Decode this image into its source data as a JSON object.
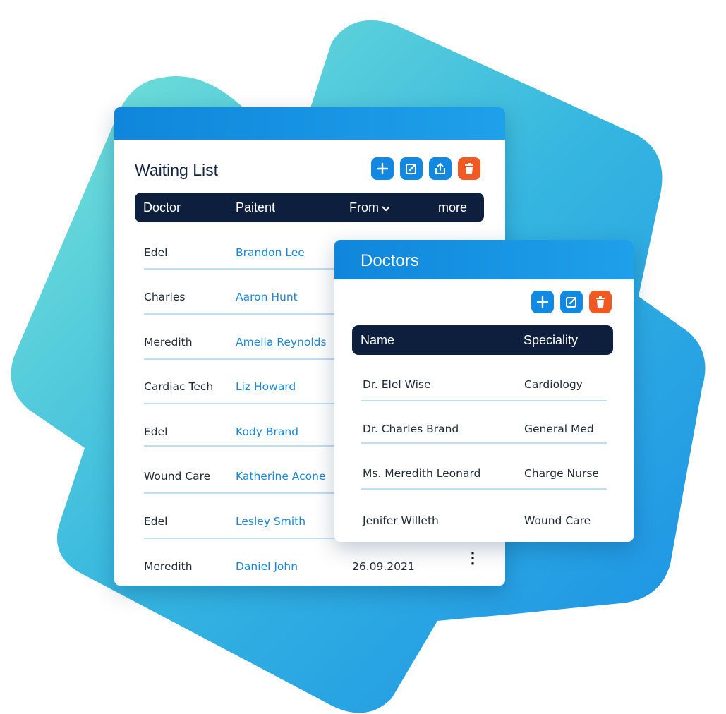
{
  "waiting_list": {
    "title": "Waiting List",
    "columns": {
      "doctor": "Doctor",
      "patient": "Paitent",
      "from": "From",
      "more": "more"
    },
    "rows": [
      {
        "doctor": "Edel",
        "patient": "Brandon Lee",
        "date": ""
      },
      {
        "doctor": "Charles",
        "patient": "Aaron Hunt",
        "date": ""
      },
      {
        "doctor": "Meredith",
        "patient": "Amelia Reynolds",
        "date": ""
      },
      {
        "doctor": "Cardiac Tech",
        "patient": "Liz Howard",
        "date": ""
      },
      {
        "doctor": "Edel",
        "patient": "Kody Brand",
        "date": ""
      },
      {
        "doctor": "Wound Care",
        "patient": "Katherine Acone",
        "date": ""
      },
      {
        "doctor": "Edel",
        "patient": "Lesley Smith",
        "date": ""
      },
      {
        "doctor": "Meredith",
        "patient": "Daniel John",
        "date": "26.09.2021"
      }
    ],
    "toolbar_icons": [
      "plus-icon",
      "edit-icon",
      "share-icon",
      "trash-icon"
    ]
  },
  "doctors": {
    "title": "Doctors",
    "columns": {
      "name": "Name",
      "speciality": "Speciality"
    },
    "rows": [
      {
        "name": "Dr. Elel Wise",
        "speciality": "Cardiology"
      },
      {
        "name": "Dr. Charles Brand",
        "speciality": "General Med"
      },
      {
        "name": "Ms. Meredith Leonard",
        "speciality": "Charge Nurse"
      },
      {
        "name": "Jenifer Willeth",
        "speciality": "Wound Care"
      }
    ],
    "toolbar_icons": [
      "plus-icon",
      "edit-icon",
      "trash-icon"
    ]
  },
  "colors": {
    "header_blue": "#1188e2",
    "table_head": "#0d1f3c",
    "delete_orange": "#f05a22",
    "patient_link": "#1a86d6"
  }
}
